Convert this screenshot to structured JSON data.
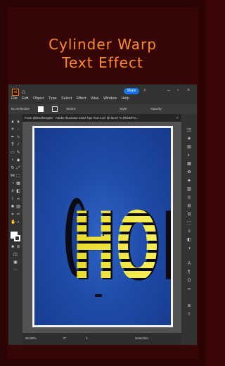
{
  "overlay": {
    "title_line1": "Cylinder Warp",
    "title_line2": "Text Effect"
  },
  "app": {
    "logo": "Ai",
    "menus": [
      "File",
      "Edit",
      "Object",
      "Type",
      "Select",
      "Effect",
      "View",
      "Window",
      "Help"
    ],
    "share_label": "Share",
    "control_bar": {
      "selection": "No Selection",
      "stroke": "Stroke:",
      "style": "Style:",
      "opacity": "Opacity:"
    },
    "document_tab": "From @DucthengDe - Adobe Illustrator 2023 Tips Tool 2.ai* @ 66.67 % (RGB/Pre...",
    "status": {
      "zoom": "66.68%",
      "angle": "0°",
      "page": "1",
      "mode": "Selection"
    }
  },
  "artwork": {
    "text": "HOPE",
    "text_color": "#f2e84a",
    "shadow_color": "#0a0a14",
    "background": "#1f4ba8"
  },
  "colors": {
    "frame": "#360505",
    "title": "#ff8a2a"
  }
}
